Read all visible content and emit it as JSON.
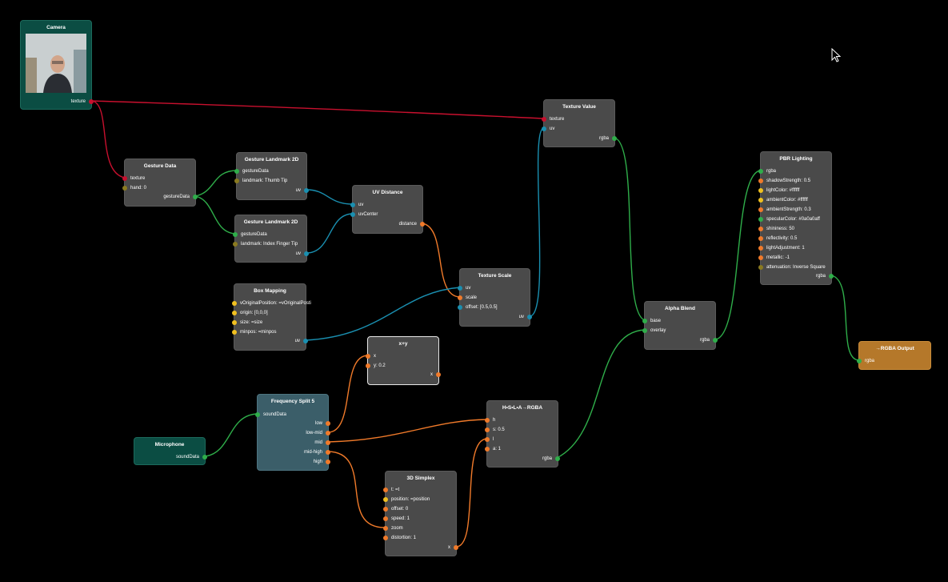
{
  "nodes": {
    "camera": {
      "title": "Camera",
      "out": [
        "texture"
      ],
      "color": "#0b4d43"
    },
    "gesture_data": {
      "title": "Gesture Data",
      "in": [
        "texture",
        "hand: 0"
      ],
      "out": [
        "gestureData"
      ]
    },
    "gesture_landmark_1": {
      "title": "Gesture Landmark 2D",
      "in": [
        "gestureData",
        "landmark: Thumb Tip"
      ],
      "out": [
        "uv"
      ]
    },
    "gesture_landmark_2": {
      "title": "Gesture Landmark 2D",
      "in": [
        "gestureData",
        "landmark: Index Finger Tip"
      ],
      "out": [
        "uv"
      ]
    },
    "uv_distance": {
      "title": "UV Distance",
      "in": [
        "uv",
        "uvCenter"
      ],
      "out": [
        "distance"
      ]
    },
    "texture_value": {
      "title": "Texture Value",
      "in": [
        "texture",
        "uv"
      ],
      "out": [
        "rgba"
      ]
    },
    "texture_scale": {
      "title": "Texture Scale",
      "in": [
        "uv",
        "scale",
        "offset: [0.5,0.5]"
      ],
      "out": [
        "uv"
      ]
    },
    "box_mapping": {
      "title": "Box Mapping",
      "in": [
        "vOriginalPosition: =vOriginalPosti",
        "origin: [0,0,0]",
        "size: =size",
        "minpos: =minpos"
      ],
      "out": [
        "uv"
      ]
    },
    "x_plus_y": {
      "title": "x+y",
      "in": [
        "x",
        "y: 0.2"
      ],
      "out": [
        "x"
      ]
    },
    "frequency_split": {
      "title": "Frequency Split 5",
      "in": [
        "soundData"
      ],
      "out": [
        "low",
        "low-mid",
        "mid",
        "mid-high",
        "high"
      ],
      "color": "#3b5e69"
    },
    "microphone": {
      "title": "Microphone",
      "out": [
        "soundData"
      ],
      "color": "#0b4d43"
    },
    "simplex": {
      "title": "3D Simplex",
      "in": [
        "t: =t",
        "position: =position",
        "offset: 0",
        "speed: 1",
        "zoom",
        "distortion: 1"
      ],
      "out": [
        "x"
      ]
    },
    "hsla": {
      "title": "H•S•L•A→RGBA",
      "in": [
        "h",
        "s: 0.5",
        "l",
        "a: 1"
      ],
      "out": [
        "rgba"
      ]
    },
    "alpha_blend": {
      "title": "Alpha Blend",
      "in": [
        "base",
        "overlay"
      ],
      "out": [
        "rgba"
      ]
    },
    "pbr": {
      "title": "PBR Lighting",
      "in": [
        "rgba",
        "shadowStrength: 0.5",
        "lightColor: #ffffff",
        "ambientColor: #ffffff",
        "ambientStrength: 0.3",
        "specularColor: #0a0a0aff",
        "shininess: 50",
        "reflectivity: 0.5",
        "lightAdjustment: 1",
        "metallic: -1",
        "attenuation: Inverse Square"
      ],
      "out": [
        "rgba"
      ]
    },
    "rgba_output": {
      "title": "→RGBA Output",
      "in": [
        "rgba"
      ],
      "color": "#b5782a"
    }
  },
  "colors": {
    "texture": "#c8102e",
    "uv": "#1a8fb0",
    "rgba": "#2fae4a",
    "number": "#f07a2a",
    "vector": "#f0c020",
    "background": "#000000"
  }
}
